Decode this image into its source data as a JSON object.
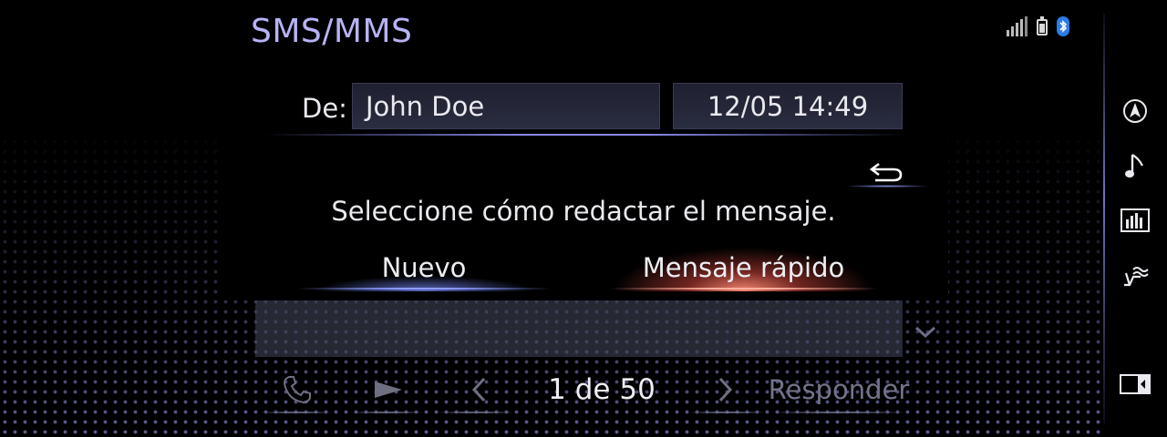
{
  "header": {
    "title": "SMS/MMS"
  },
  "status": {
    "signal_icon": "signal-icon",
    "battery_icon": "battery-icon",
    "bluetooth_icon": "bluetooth-icon",
    "bluetooth_color": "#2b7de9"
  },
  "message": {
    "from_label": "De:",
    "from_value": "John Doe",
    "datetime": "12/05  14:49"
  },
  "dialog": {
    "prompt": "Seleccione cómo redactar el mensaje.",
    "options": [
      {
        "label": "Nuevo"
      },
      {
        "label": "Mensaje rápido",
        "selected": true
      }
    ],
    "back_icon": "back-arrow-icon"
  },
  "toolbar": {
    "pager": "1 de 50",
    "reply_label": "Responder",
    "call_icon": "phone-icon",
    "play_icon": "play-icon",
    "prev_icon": "chevron-left-icon",
    "next_icon": "chevron-right-icon"
  },
  "rail": {
    "items": [
      "navigation-icon",
      "music-note-icon",
      "equalizer-icon",
      "climate-seat-icon",
      "split-screen-icon"
    ]
  },
  "colors": {
    "accent": "#b7b3f5",
    "selected_glow": "#ff8c78",
    "focus_glow": "#8f9bff"
  }
}
